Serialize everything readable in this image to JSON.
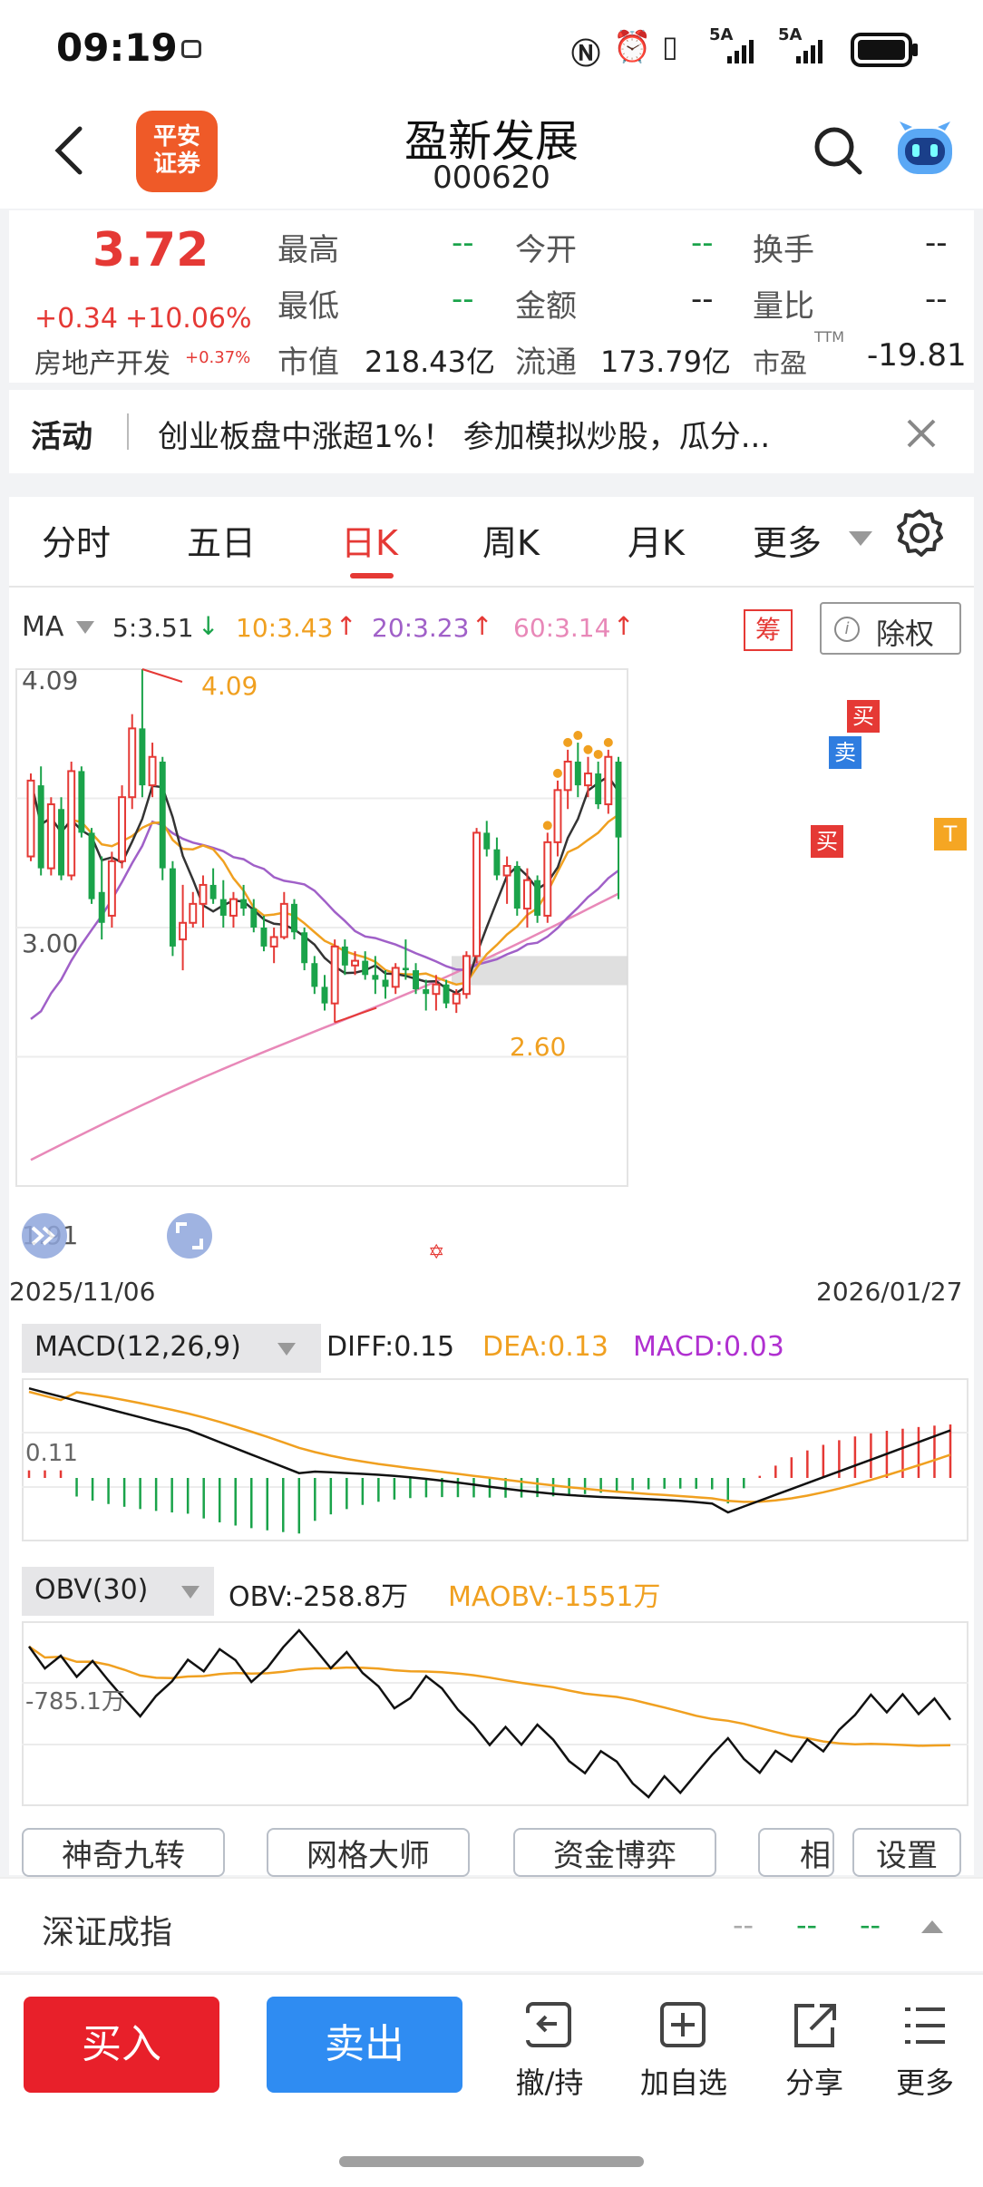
{
  "status_bar": {
    "time": "09:19",
    "signal_a": "5A",
    "signal_b": "5A"
  },
  "header": {
    "broker_logo": "平安\n证券",
    "stock_name": "盈新发展",
    "stock_code": "000620"
  },
  "quote": {
    "price": "3.72",
    "change": "+0.34",
    "change_pct": "+10.06%",
    "sector": "房地产开发",
    "sector_pct": "+0.37%",
    "fields": [
      {
        "label": "最高",
        "value": "--"
      },
      {
        "label": "今开",
        "value": "--"
      },
      {
        "label": "换手",
        "value": "--"
      },
      {
        "label": "最低",
        "value": "--"
      },
      {
        "label": "金额",
        "value": "--"
      },
      {
        "label": "量比",
        "value": "--"
      },
      {
        "label": "市值",
        "value": "218.43亿"
      },
      {
        "label": "流通",
        "value": "173.79亿"
      },
      {
        "label": "市盈",
        "value": "-19.81",
        "sup": "TTM"
      }
    ]
  },
  "activity": {
    "label": "活动",
    "text": "创业板盘中涨超1%！ 参加模拟炒股，瓜分..."
  },
  "tabs": [
    "分时",
    "五日",
    "日K",
    "周K",
    "月K",
    "更多"
  ],
  "active_tab": "日K",
  "ma_legend": {
    "label": "MA",
    "items": [
      {
        "text": "5:3.51",
        "color": "#333333",
        "arrow": "↓",
        "arrow_color": "#1aa34a"
      },
      {
        "text": "10:3.43",
        "color": "#f0a020",
        "arrow": "↑",
        "arrow_color": "#e53935"
      },
      {
        "text": "20:3.23",
        "color": "#a060c8",
        "arrow": "↑",
        "arrow_color": "#e53935"
      },
      {
        "text": "60:3.14",
        "color": "#e888b8",
        "arrow": "↑",
        "arrow_color": "#e53935"
      }
    ],
    "chip_btn": "筹",
    "exright_btn": "除权"
  },
  "kline": {
    "y_labels": [
      "4.09",
      "3.00",
      "1.91"
    ],
    "max_marker": "4.09",
    "min_marker": "2.60",
    "date_start": "2025/11/06",
    "date_end": "2026/01/27",
    "badges": [
      "买",
      "卖",
      "买",
      "T"
    ]
  },
  "macd": {
    "title": "MACD(12,26,9)",
    "diff": "DIFF:0.15",
    "dea": "DEA:0.13",
    "macd": "MACD:0.03",
    "y_label": "0.11"
  },
  "obv": {
    "title": "OBV(30)",
    "obv": "OBV:-258.8万",
    "maobv": "MAOBV:-1551万",
    "y_label": "-785.1万"
  },
  "tools": [
    "神奇九转",
    "网格大师",
    "资金博弈",
    "相",
    "设置"
  ],
  "index_bar": {
    "name": "深证成指",
    "v1": "--",
    "v2": "--",
    "v3": "--"
  },
  "bottom": {
    "buy": "买入",
    "sell": "卖出",
    "actions": [
      "撤/持",
      "加自选",
      "分享",
      "更多"
    ]
  },
  "colors": {
    "up": "#e53935",
    "down": "#1aa34a",
    "buy_btn": "#e8202a",
    "sell_btn": "#2f8cf2",
    "accent": "#ef5a28"
  },
  "chart_data": {
    "type": "candlestick",
    "x_range": [
      "2025/11/06",
      "2026/01/27"
    ],
    "ylim": [
      1.91,
      4.09
    ],
    "y_ticks": [
      4.09,
      3.0,
      1.91
    ],
    "ohlc": [
      [
        3.3,
        3.65,
        3.28,
        3.62
      ],
      [
        3.6,
        3.68,
        3.22,
        3.25
      ],
      [
        3.25,
        3.55,
        3.22,
        3.52
      ],
      [
        3.5,
        3.55,
        3.2,
        3.22
      ],
      [
        3.22,
        3.7,
        3.2,
        3.66
      ],
      [
        3.66,
        3.68,
        3.38,
        3.4
      ],
      [
        3.4,
        3.42,
        3.1,
        3.12
      ],
      [
        3.15,
        3.3,
        2.95,
        3.02
      ],
      [
        3.05,
        3.32,
        3.0,
        3.28
      ],
      [
        3.28,
        3.6,
        3.25,
        3.55
      ],
      [
        3.55,
        3.9,
        3.5,
        3.84
      ],
      [
        3.84,
        4.09,
        3.55,
        3.6
      ],
      [
        3.6,
        3.78,
        3.55,
        3.72
      ],
      [
        3.7,
        3.72,
        3.2,
        3.25
      ],
      [
        3.25,
        3.28,
        2.88,
        2.92
      ],
      [
        2.95,
        3.18,
        2.82,
        3.02
      ],
      [
        3.02,
        3.15,
        3.0,
        3.1
      ],
      [
        3.1,
        3.22,
        3.0,
        3.18
      ],
      [
        3.18,
        3.25,
        3.1,
        3.12
      ],
      [
        3.12,
        3.2,
        3.0,
        3.05
      ],
      [
        3.05,
        3.15,
        3.0,
        3.12
      ],
      [
        3.12,
        3.18,
        3.05,
        3.08
      ],
      [
        3.08,
        3.12,
        2.98,
        3.0
      ],
      [
        3.0,
        3.05,
        2.9,
        2.92
      ],
      [
        2.92,
        3.0,
        2.85,
        2.96
      ],
      [
        2.96,
        3.15,
        2.95,
        3.1
      ],
      [
        3.1,
        3.12,
        2.95,
        2.98
      ],
      [
        2.98,
        3.0,
        2.82,
        2.85
      ],
      [
        2.85,
        2.88,
        2.72,
        2.75
      ],
      [
        2.75,
        2.8,
        2.65,
        2.68
      ],
      [
        2.68,
        2.95,
        2.6,
        2.92
      ],
      [
        2.92,
        2.95,
        2.8,
        2.84
      ],
      [
        2.84,
        2.9,
        2.8,
        2.86
      ],
      [
        2.86,
        2.9,
        2.78,
        2.8
      ],
      [
        2.8,
        2.88,
        2.72,
        2.78
      ],
      [
        2.78,
        2.82,
        2.7,
        2.75
      ],
      [
        2.75,
        2.85,
        2.72,
        2.83
      ],
      [
        2.83,
        2.95,
        2.78,
        2.82
      ],
      [
        2.82,
        2.85,
        2.72,
        2.74
      ],
      [
        2.74,
        2.78,
        2.65,
        2.72
      ],
      [
        2.72,
        2.8,
        2.65,
        2.76
      ],
      [
        2.76,
        2.78,
        2.66,
        2.68
      ],
      [
        2.68,
        2.74,
        2.64,
        2.72
      ],
      [
        2.72,
        2.9,
        2.7,
        2.88
      ],
      [
        2.88,
        3.42,
        2.85,
        3.4
      ],
      [
        3.4,
        3.45,
        3.3,
        3.33
      ],
      [
        3.33,
        3.38,
        3.2,
        3.22
      ],
      [
        3.22,
        3.3,
        3.1,
        3.26
      ],
      [
        3.26,
        3.28,
        3.05,
        3.08
      ],
      [
        3.08,
        3.25,
        3.0,
        3.2
      ],
      [
        3.2,
        3.22,
        3.02,
        3.05
      ],
      [
        3.05,
        3.4,
        3.02,
        3.36
      ],
      [
        3.36,
        3.62,
        3.3,
        3.58
      ],
      [
        3.58,
        3.75,
        3.5,
        3.7
      ],
      [
        3.7,
        3.78,
        3.55,
        3.6
      ],
      [
        3.6,
        3.72,
        3.55,
        3.65
      ],
      [
        3.65,
        3.7,
        3.5,
        3.52
      ],
      [
        3.52,
        3.75,
        3.48,
        3.72
      ],
      [
        3.7,
        3.72,
        3.12,
        3.38
      ]
    ],
    "ma": [
      {
        "name": "MA5",
        "value": 3.51
      },
      {
        "name": "MA10",
        "value": 3.43
      },
      {
        "name": "MA20",
        "value": 3.23
      },
      {
        "name": "MA60",
        "value": 3.14
      }
    ],
    "annotations": [
      {
        "text": "4.09",
        "type": "high"
      },
      {
        "text": "2.60",
        "type": "low"
      }
    ],
    "macd": {
      "diff": 0.15,
      "dea": 0.13,
      "macd": 0.03,
      "tick": 0.11
    },
    "obv": {
      "obv": "-258.8万",
      "maobv": "-1551万",
      "tick": "-785.1万"
    }
  }
}
